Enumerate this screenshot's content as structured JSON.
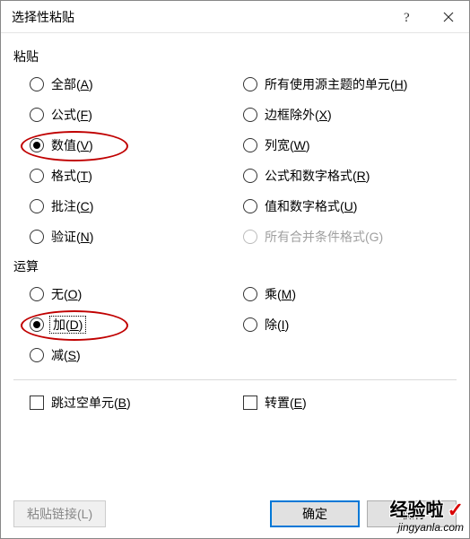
{
  "window": {
    "title": "选择性粘贴"
  },
  "groups": {
    "paste": {
      "label": "粘贴",
      "left": [
        {
          "pre": "全部(",
          "acc": "A",
          "post": ")",
          "selected": false
        },
        {
          "pre": "公式(",
          "acc": "F",
          "post": ")",
          "selected": false
        },
        {
          "pre": "数值(",
          "acc": "V",
          "post": ")",
          "selected": true,
          "highlight": true
        },
        {
          "pre": "格式(",
          "acc": "T",
          "post": ")",
          "selected": false
        },
        {
          "pre": "批注(",
          "acc": "C",
          "post": ")",
          "selected": false
        },
        {
          "pre": "验证(",
          "acc": "N",
          "post": ")",
          "selected": false
        }
      ],
      "right": [
        {
          "pre": "所有使用源主题的单元(",
          "acc": "H",
          "post": ")",
          "selected": false
        },
        {
          "pre": "边框除外(",
          "acc": "X",
          "post": ")",
          "selected": false
        },
        {
          "pre": "列宽(",
          "acc": "W",
          "post": ")",
          "selected": false
        },
        {
          "pre": "公式和数字格式(",
          "acc": "R",
          "post": ")",
          "selected": false
        },
        {
          "pre": "值和数字格式(",
          "acc": "U",
          "post": ")",
          "selected": false
        },
        {
          "pre": "所有合并条件格式(G)",
          "acc": "",
          "post": "",
          "disabled": true
        }
      ]
    },
    "operation": {
      "label": "运算",
      "left": [
        {
          "pre": "无(",
          "acc": "O",
          "post": ")",
          "selected": false
        },
        {
          "pre": "加(",
          "acc": "D",
          "post": ")",
          "selected": true,
          "highlight": true,
          "focused": true
        },
        {
          "pre": "减(",
          "acc": "S",
          "post": ")",
          "selected": false
        }
      ],
      "right": [
        {
          "pre": "乘(",
          "acc": "M",
          "post": ")",
          "selected": false
        },
        {
          "pre": "除(",
          "acc": "I",
          "post": ")",
          "selected": false
        }
      ]
    }
  },
  "checks": {
    "skip_blanks": {
      "pre": "跳过空单元(",
      "acc": "B",
      "post": ")",
      "checked": false
    },
    "transpose": {
      "pre": "转置(",
      "acc": "E",
      "post": ")",
      "checked": false
    }
  },
  "buttons": {
    "paste_link": "粘贴链接(L)",
    "ok": "确定",
    "cancel": "取消"
  },
  "watermark": {
    "text": "经验啦",
    "sub": "jingyanla.com"
  }
}
